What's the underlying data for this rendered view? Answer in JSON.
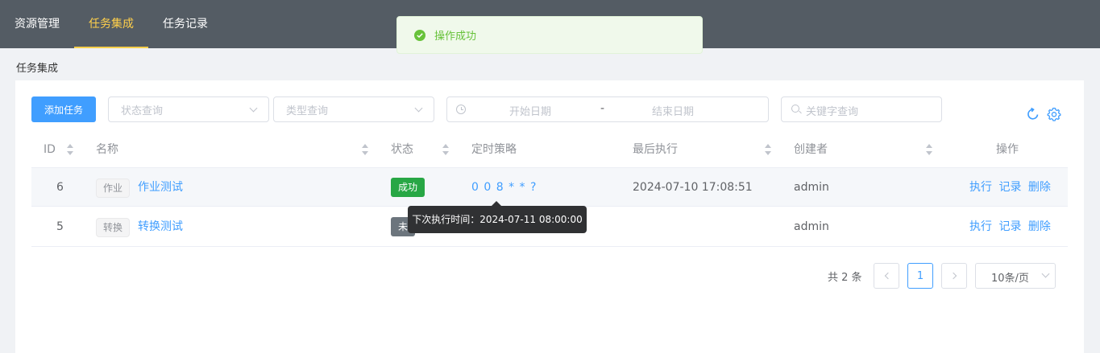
{
  "nav": {
    "items": [
      {
        "label": "资源管理",
        "active": false
      },
      {
        "label": "任务集成",
        "active": true
      },
      {
        "label": "任务记录",
        "active": false
      }
    ]
  },
  "toast": {
    "text": "操作成功",
    "color": "#67c23a"
  },
  "breadcrumb": "任务集成",
  "toolbar": {
    "add_label": "添加任务",
    "status_placeholder": "状态查询",
    "type_placeholder": "类型查询",
    "date_start_placeholder": "开始日期",
    "date_separator": "-",
    "date_end_placeholder": "结束日期",
    "keyword_placeholder": "关键字查询",
    "icons": [
      "refresh-icon",
      "gear-icon"
    ]
  },
  "table": {
    "columns": [
      "ID",
      "名称",
      "状态",
      "定时策略",
      "最后执行",
      "创建者",
      "操作"
    ],
    "rows": [
      {
        "id": "6",
        "type": "作业",
        "name": "作业测试",
        "status": "成功",
        "schedule": "0 0 8 * * ?",
        "last_run": "2024-07-10 17:08:51",
        "creator": "admin",
        "actions": [
          "执行",
          "记录",
          "删除"
        ]
      },
      {
        "id": "5",
        "type": "转换",
        "name": "转换测试",
        "status": "未",
        "schedule": "",
        "last_run": "",
        "creator": "admin",
        "actions": [
          "执行",
          "记录",
          "删除"
        ]
      }
    ]
  },
  "tooltip": "下次执行时间：2024-07-11 08:00:00",
  "pagination": {
    "total_text": "共 2 条",
    "current_page": "1",
    "page_size": "10条/页"
  },
  "colors": {
    "topbar": "#545c64",
    "nav_active": "#ffd04b",
    "primary": "#409eff",
    "success_tag": "#28a745",
    "pending_tag": "#6c757d"
  }
}
